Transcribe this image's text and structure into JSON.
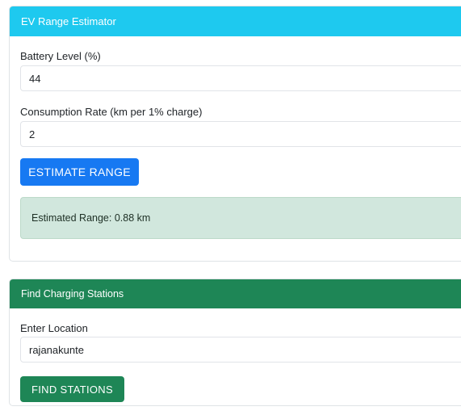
{
  "ev_estimator": {
    "title": "EV Range Estimator",
    "battery_label": "Battery Level (%)",
    "battery_value": "44",
    "consumption_label": "Consumption Rate (km per 1% charge)",
    "consumption_value": "2",
    "estimate_button": "ESTIMATE RANGE",
    "result_text": "Estimated Range: 0.88 km"
  },
  "charging_stations": {
    "title": "Find Charging Stations",
    "location_label": "Enter Location",
    "location_value": "rajanakunte",
    "find_button": "FIND STATIONS"
  },
  "colors": {
    "ev_header": "#1ec9ef",
    "stations_header": "#1e8656",
    "primary_button": "#1779f2",
    "success_button": "#1e8656",
    "result_background": "#d1e7dd"
  }
}
